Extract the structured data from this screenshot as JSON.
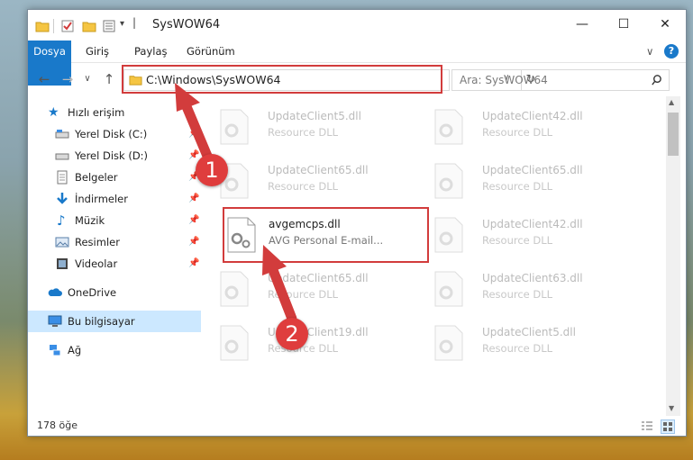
{
  "window": {
    "title": "SysWOW64",
    "minimize": "—",
    "maximize": "☐",
    "close": "✕"
  },
  "ribbon": {
    "tabs": [
      "Dosya",
      "Giriş",
      "Paylaş",
      "Görünüm"
    ],
    "collapse": "∨",
    "help": "?"
  },
  "nav": {
    "back": "←",
    "forward": "→",
    "recent": "∨",
    "up": "↑"
  },
  "address": {
    "path": "C:\\Windows\\SysWOW64",
    "dropdown": "∨",
    "refresh": "↻"
  },
  "search": {
    "placeholder": "Ara: SysWOW64"
  },
  "sidebar": {
    "quick_access": "Hızlı erişim",
    "items": [
      {
        "label": "Yerel Disk (C:)"
      },
      {
        "label": "Yerel Disk (D:)"
      },
      {
        "label": "Belgeler"
      },
      {
        "label": "İndirmeler"
      },
      {
        "label": "Müzik"
      },
      {
        "label": "Resimler"
      },
      {
        "label": "Videolar"
      }
    ],
    "onedrive": "OneDrive",
    "this_pc": "Bu bilgisayar",
    "network": "Ağ"
  },
  "files": [
    {
      "name": "UpdateClient5.dll",
      "desc": "Resource DLL"
    },
    {
      "name": "UpdateClient42.dll",
      "desc": "Resource DLL"
    },
    {
      "name": "UpdateClient65.dll",
      "desc": "Resource DLL"
    },
    {
      "name": "UpdateClient65.dll",
      "desc": "Resource DLL"
    },
    {
      "name": "avgemcps.dll",
      "desc": "AVG Personal E-mail..."
    },
    {
      "name": "UpdateClient42.dll",
      "desc": "Resource DLL"
    },
    {
      "name": "UpdateClient65.dll",
      "desc": "Resource DLL"
    },
    {
      "name": "UpdateClient63.dll",
      "desc": "Resource DLL"
    },
    {
      "name": "UpdateClient19.dll",
      "desc": "Resource DLL"
    },
    {
      "name": "UpdateClient5.dll",
      "desc": "Resource DLL"
    }
  ],
  "status": {
    "count": "178 öğe"
  },
  "annotations": {
    "badge1": "1",
    "badge2": "2"
  },
  "colors": {
    "accent": "#1979ca",
    "highlight": "#d23c3c"
  }
}
